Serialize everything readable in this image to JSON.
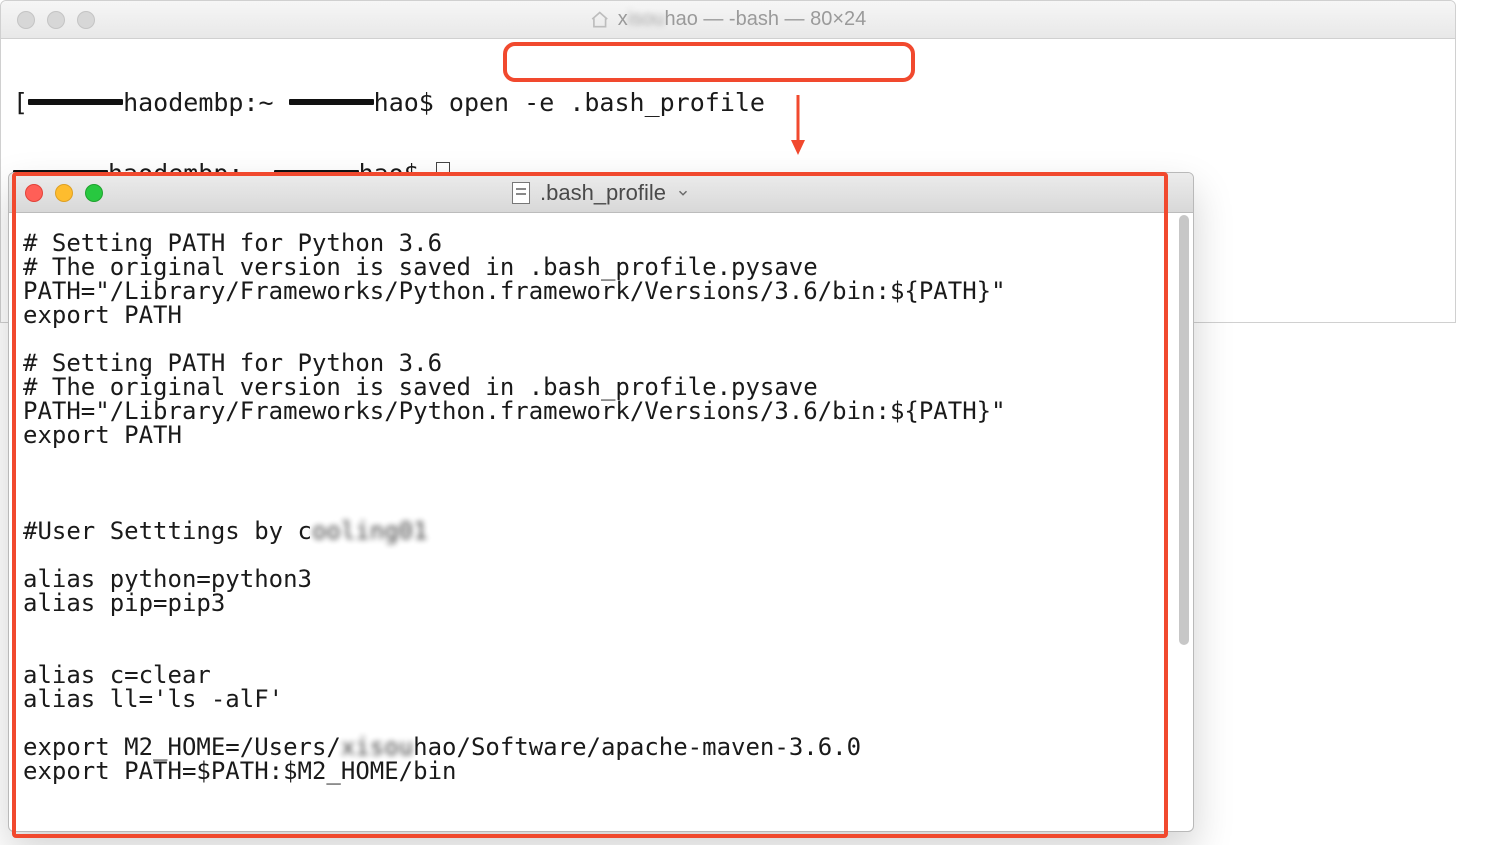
{
  "terminal": {
    "title_user": "hao",
    "title_redacted_prefix": "x",
    "title_rest": " — -bash — 80×24",
    "prompt1_host_prefix": "haodembp:~ ",
    "prompt1_user_suffix": "hao$ ",
    "command1": "open -e .bash_profile",
    "prompt2_host_prefix": "haodembp:~ ",
    "prompt2_user_suffix": "hao$ "
  },
  "editor": {
    "title": ".bash_profile",
    "lines": [
      "# Setting PATH for Python 3.6",
      "# The original version is saved in .bash_profile.pysave",
      "PATH=\"/Library/Frameworks/Python.framework/Versions/3.6/bin:${PATH}\"",
      "export PATH",
      "",
      "# Setting PATH for Python 3.6",
      "# The original version is saved in .bash_profile.pysave",
      "PATH=\"/Library/Frameworks/Python.framework/Versions/3.6/bin:${PATH}\"",
      "export PATH",
      "",
      "",
      "",
      "#User Setttings by c███████",
      "",
      "alias python=python3",
      "alias pip=pip3",
      "",
      "",
      "alias c=clear",
      "alias ll='ls -alF'",
      "",
      "export M2_HOME=/Users/██████hao/Software/apache-maven-3.6.0",
      "export PATH=$PATH:$M2_HOME/bin"
    ]
  }
}
